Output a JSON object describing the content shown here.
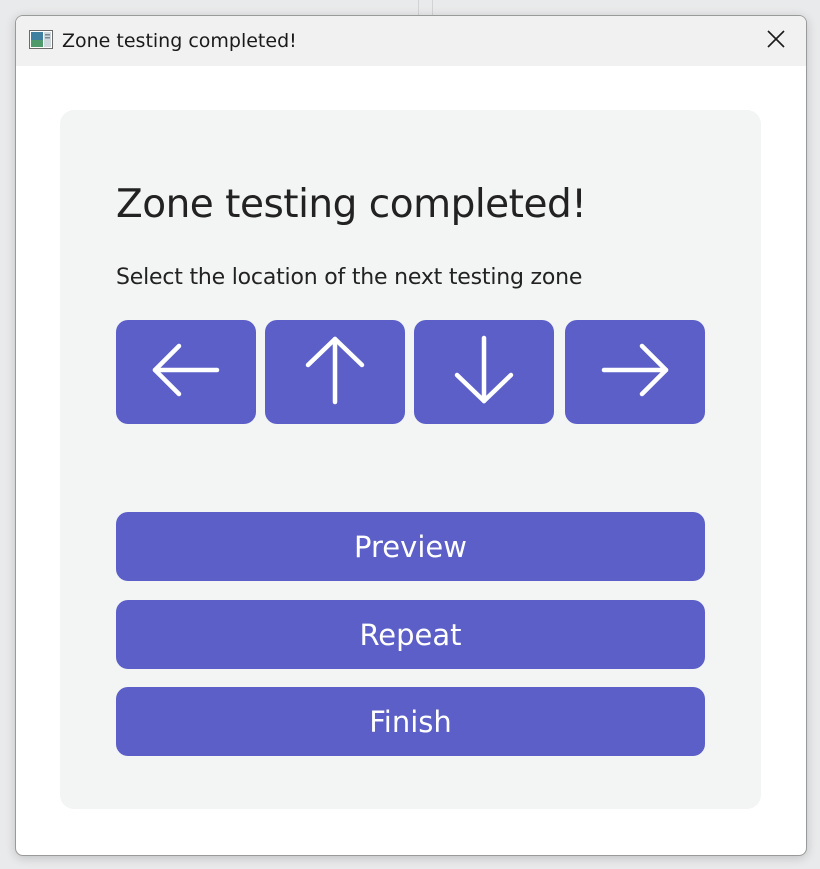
{
  "window": {
    "title": "Zone testing completed!"
  },
  "dialog": {
    "heading": "Zone testing completed!",
    "instruction": "Select the location of the next testing zone",
    "direction_buttons": [
      {
        "icon": "arrow-left-icon"
      },
      {
        "icon": "arrow-up-icon"
      },
      {
        "icon": "arrow-down-icon"
      },
      {
        "icon": "arrow-right-icon"
      }
    ],
    "actions": {
      "preview_label": "Preview",
      "repeat_label": "Repeat",
      "finish_label": "Finish"
    }
  },
  "colors": {
    "accent": "#5b5fc7",
    "card_background": "#f3f4f4",
    "titlebar_background": "#f1f1f1"
  }
}
